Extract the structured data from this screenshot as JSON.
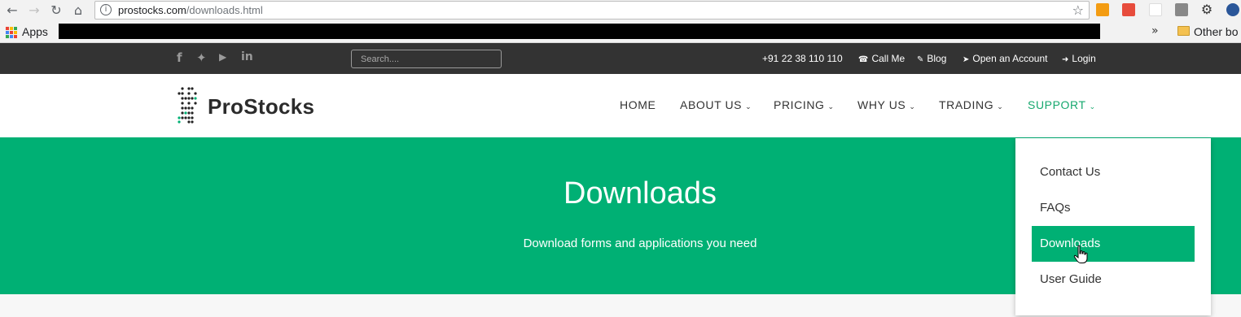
{
  "browser": {
    "url_host": "prostocks.com",
    "url_path": "/downloads.html",
    "bookmarks": {
      "apps_label": "Apps",
      "other_label": "Other bo"
    }
  },
  "topbar": {
    "social_icons": [
      "facebook-icon",
      "twitter-icon",
      "youtube-icon",
      "linkedin-icon"
    ],
    "search_placeholder": "Search....",
    "phone": "+91 22 38 110 110",
    "call_me": "Call Me",
    "blog": "Blog",
    "open_account": "Open an Account",
    "login": "Login"
  },
  "header": {
    "logo_text": "ProStocks",
    "menu": [
      {
        "label": "HOME",
        "caret": false
      },
      {
        "label": "ABOUT US",
        "caret": true
      },
      {
        "label": "PRICING",
        "caret": true
      },
      {
        "label": "WHY US",
        "caret": true
      },
      {
        "label": "TRADING",
        "caret": true
      },
      {
        "label": "SUPPORT",
        "caret": true,
        "active": true
      }
    ]
  },
  "hero": {
    "title": "Downloads",
    "subtitle": "Download forms and applications you need"
  },
  "support_dropdown": {
    "items": [
      {
        "label": "Contact Us"
      },
      {
        "label": "FAQs"
      },
      {
        "label": "Downloads",
        "selected": true
      },
      {
        "label": "User Guide"
      }
    ]
  },
  "colors": {
    "brand_green": "#00b074",
    "topbar_bg": "#333333",
    "active_menu": "#16a86e"
  }
}
